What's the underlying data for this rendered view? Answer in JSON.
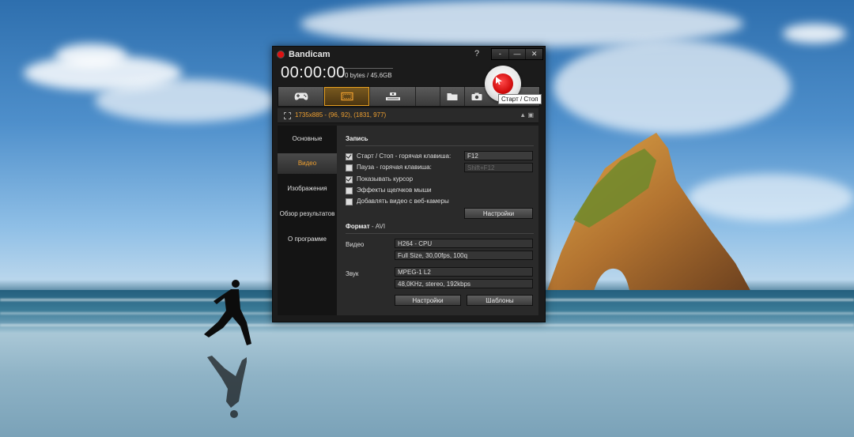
{
  "app": {
    "title": "Bandicam",
    "help_label": "?",
    "window_buttons": [
      "-",
      "—",
      "✕"
    ],
    "timer": "00:00:00",
    "filesize": "0 bytes / 45.6GB",
    "record_tooltip": "Старт / Стоп",
    "accent_color": "#f0a030"
  },
  "toolbar": {
    "items": [
      {
        "icon": "gamepad-icon"
      },
      {
        "icon": "screen-rectangle-icon",
        "active": true
      },
      {
        "icon": "hdmi-device-icon"
      },
      {
        "icon": "folder-icon"
      },
      {
        "icon": "camera-icon"
      }
    ]
  },
  "region": {
    "text": "1735x885 - (96, 92), (1831, 977)",
    "controls": "▲ ▣"
  },
  "sidebar": {
    "items": [
      {
        "label": "Основные"
      },
      {
        "label": "Видео",
        "selected": true
      },
      {
        "label": "Изображения"
      },
      {
        "label": "Обзор результатов"
      },
      {
        "label": "О программе"
      }
    ]
  },
  "recording": {
    "section_title": "Запись",
    "start_stop_label": "Старт / Стоп - горячая клавиша:",
    "start_stop_key": "F12",
    "pause_label": "Пауза - горячая клавиша:",
    "pause_key": "Shift+F12",
    "show_cursor_label": "Показывать курсор",
    "mouse_click_effects_label": "Эффекты щелчков мыши",
    "webcam_overlay_label": "Добавлять видео с веб-камеры",
    "settings_button": "Настройки"
  },
  "format": {
    "section_title": "Формат",
    "value": "- AVI",
    "video_label": "Видео",
    "video_codec": "H264 - CPU",
    "video_details": "Full Size, 30,00fps, 100q",
    "audio_label": "Звук",
    "audio_codec": "MPEG-1 L2",
    "audio_details": "48,0KHz, stereo, 192kbps",
    "settings_button": "Настройки",
    "presets_button": "Шаблоны"
  }
}
